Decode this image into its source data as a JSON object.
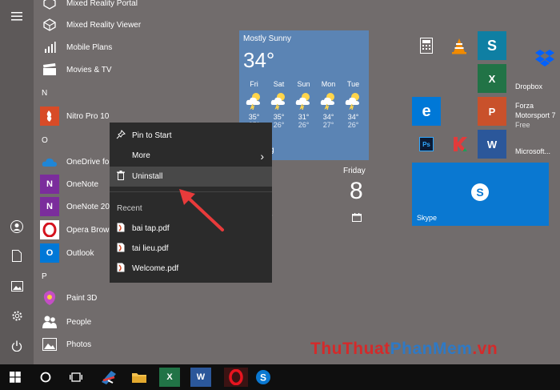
{
  "apps": [
    {
      "label": "Mixed Reality Portal"
    },
    {
      "label": "Mixed Reality Viewer"
    },
    {
      "label": "Mobile Plans"
    },
    {
      "label": "Movies & TV"
    },
    {
      "label": "Nitro Pro 10"
    },
    {
      "label": "OneDrive for"
    },
    {
      "label": "OneNote"
    },
    {
      "label": "OneNote 20"
    },
    {
      "label": "Opera Brows"
    },
    {
      "label": "Outlook"
    },
    {
      "label": "Paint 3D"
    },
    {
      "label": "People"
    },
    {
      "label": "Photos"
    }
  ],
  "section_letters": {
    "n": "N",
    "o": "O",
    "p": "P"
  },
  "context_menu": {
    "pin_to_start": "Pin to Start",
    "more": "More",
    "uninstall": "Uninstall",
    "recent_header": "Recent",
    "recent_files": [
      "bai tap.pdf",
      "tai lieu.pdf",
      "Welcome.pdf"
    ]
  },
  "weather": {
    "condition": "Mostly Sunny",
    "temperature": "34°",
    "days": [
      {
        "day": "Fri",
        "high": "35°",
        "low": "25°"
      },
      {
        "day": "Sat",
        "high": "35°",
        "low": "26°"
      },
      {
        "day": "Sun",
        "high": "31°",
        "low": "26°"
      },
      {
        "day": "Mon",
        "high": "34°",
        "low": "27°"
      },
      {
        "day": "Tue",
        "high": "34°",
        "low": "26°"
      }
    ],
    "footer_fragment": "g"
  },
  "calendar": {
    "day_name": "Friday",
    "date": "8"
  },
  "tiles": {
    "dropbox": "Dropbox",
    "forza_title": "Forza",
    "forza_subtitle": "Motorsport 7",
    "forza_price": "Free",
    "microsoft_fragment": "Microsoft...",
    "skype": "Skype",
    "mail_fragment": "r"
  },
  "watermark": {
    "part1": "ThuThuat",
    "part2": "PhanMem",
    "part3": ".vn"
  },
  "colors": {
    "accent_blue": "#0078d7",
    "onenote_purple": "#7b2d9c",
    "excel_green": "#217346",
    "word_blue": "#2b579a",
    "powerpoint_red": "#c9512b",
    "opera_red": "#d4121d",
    "arrow_red": "#e83b3b",
    "watermark_red": "#d42a2a",
    "watermark_blue": "#2f79c4"
  }
}
